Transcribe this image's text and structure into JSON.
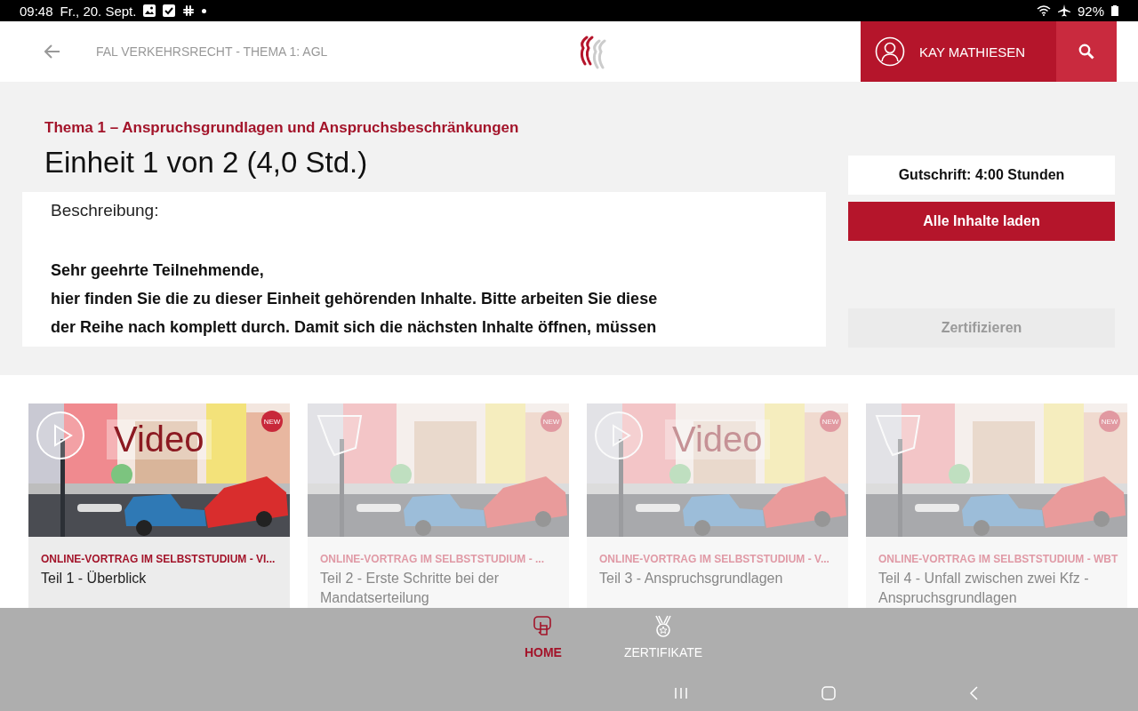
{
  "status_bar": {
    "time": "09:48",
    "date": "Fr., 20. Sept.",
    "battery": "92%"
  },
  "header": {
    "breadcrumb": "FAL VERKEHRSRECHT - THEMA 1: AGL",
    "user": "KAY MATHIESEN"
  },
  "unit": {
    "topic": "Thema 1 – Anspruchsgrundlagen und Anspruchsbeschränkungen",
    "title": "Einheit 1 von 2 (4,0 Std.)",
    "description_label": "Beschreibung:",
    "description_lines": [
      "Sehr geehrte Teilnehmende,",
      "hier finden Sie die zu dieser Einheit gehörenden Inhalte. Bitte arbeiten Sie diese",
      "der Reihe nach komplett durch. Damit sich die nächsten Inhalte öffnen, müssen"
    ]
  },
  "sidebar": {
    "credit": "Gutschrift: 4:00 Stunden",
    "load_button": "Alle Inhalte laden",
    "certify_button": {
      "label": "Zertifizieren",
      "disabled": true
    }
  },
  "cards": [
    {
      "kind": "video",
      "overlay": "Video",
      "badge": "NEW",
      "category": "ONLINE-VORTRAG IM SELBSTSTUDIUM - VI...",
      "title": "Teil 1 - Überblick",
      "disabled": false
    },
    {
      "kind": "wbt",
      "badge": "NEW",
      "category": "ONLINE-VORTRAG IM SELBSTSTUDIUM - ...",
      "title": "Teil 2 - Erste Schritte bei der Mandatserteilung",
      "disabled": true
    },
    {
      "kind": "video",
      "overlay": "Video",
      "badge": "NEW",
      "category": "ONLINE-VORTRAG IM SELBSTSTUDIUM - V...",
      "title": "Teil 3 - Anspruchsgrundlagen",
      "disabled": true
    },
    {
      "kind": "wbt",
      "badge": "NEW",
      "category": "ONLINE-VORTRAG IM SELBSTSTUDIUM - WBT",
      "title": "Teil 4 - Unfall zwischen zwei Kfz - Anspruchsgrundlagen",
      "disabled": true
    }
  ],
  "bottom_nav": [
    {
      "kind": "home",
      "label": "HOME",
      "selected": true
    },
    {
      "kind": "certificates",
      "label": "ZERTIFIKATE",
      "selected": false
    }
  ]
}
